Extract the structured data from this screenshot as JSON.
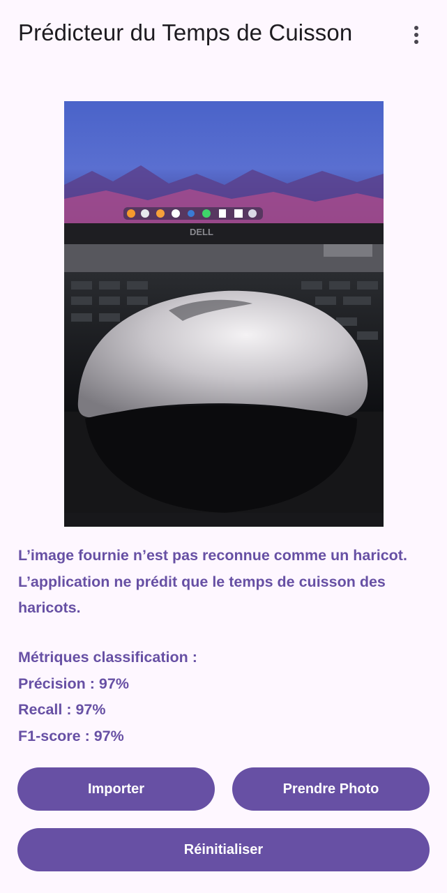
{
  "app_bar": {
    "title": "Prédicteur du Temps de Cuisson",
    "menu_icon": "more-vert-icon"
  },
  "image": {
    "description_icon": "photo"
  },
  "result": {
    "message": "L’image fournie n’est pas reconnue comme un haricot. L’application ne prédit que le temps de cuisson des haricots."
  },
  "metrics": {
    "heading": "Métriques classification :",
    "precision": "Précision : 97%",
    "recall": "Recall : 97%",
    "f1": "F1-score : 97%"
  },
  "actions": {
    "import_label": "Importer",
    "photo_label": "Prendre Photo",
    "reset_label": "Réinitialiser"
  },
  "colors": {
    "background": "#fef7ff",
    "primary": "#6750a4",
    "on_primary": "#ffffff"
  }
}
